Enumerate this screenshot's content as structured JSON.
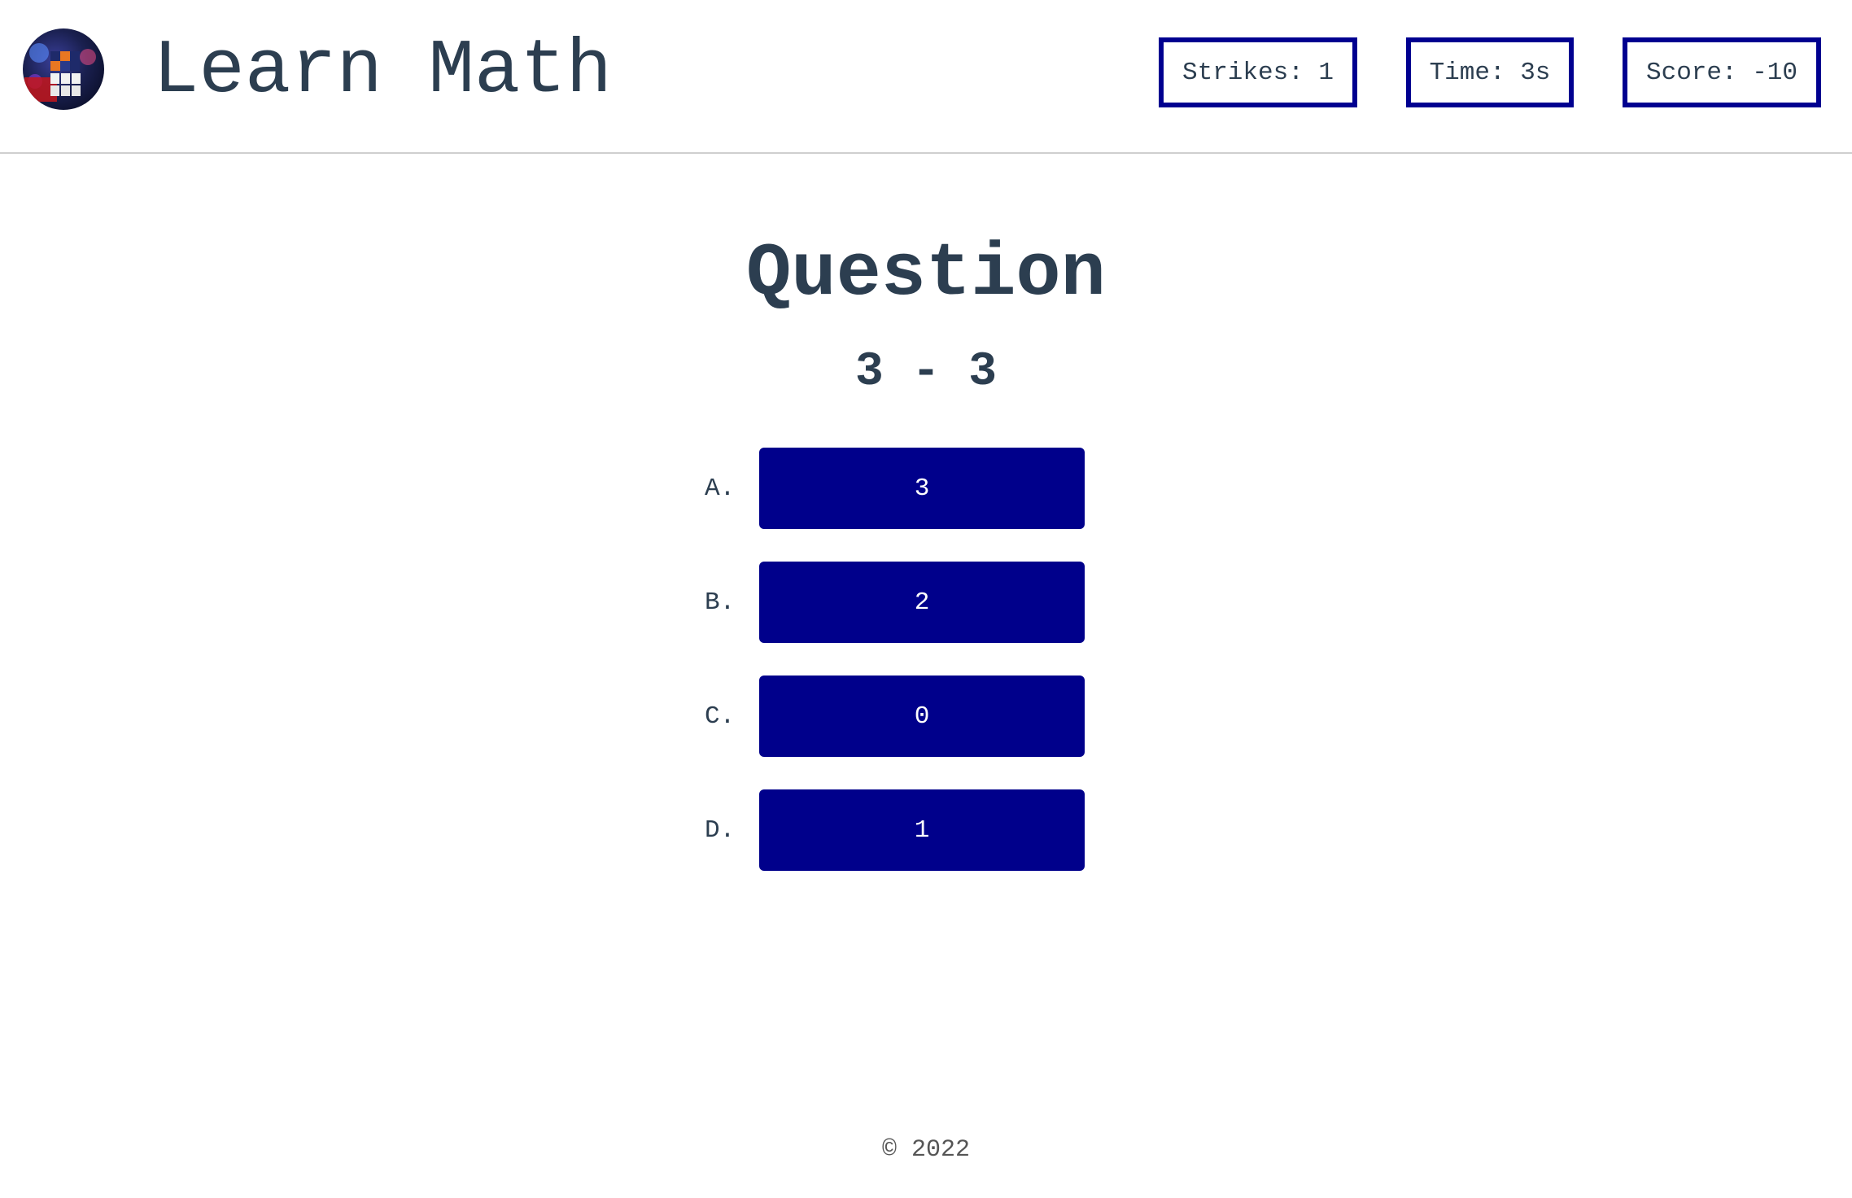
{
  "header": {
    "title": "Learn Math",
    "logo_icon": "rubiks-cube-icon",
    "strikes": "Strikes: 1",
    "time": "Time: 3s",
    "score": "Score: -10"
  },
  "question": {
    "title": "Question",
    "expression": "3 - 3"
  },
  "answers": [
    {
      "letter": "A.",
      "value": "3"
    },
    {
      "letter": "B.",
      "value": "2"
    },
    {
      "letter": "C.",
      "value": "0"
    },
    {
      "letter": "D.",
      "value": "1"
    }
  ],
  "footer": {
    "copyright": "© 2022"
  },
  "colors": {
    "accent": "#00008b",
    "text": "#2c3e50"
  }
}
